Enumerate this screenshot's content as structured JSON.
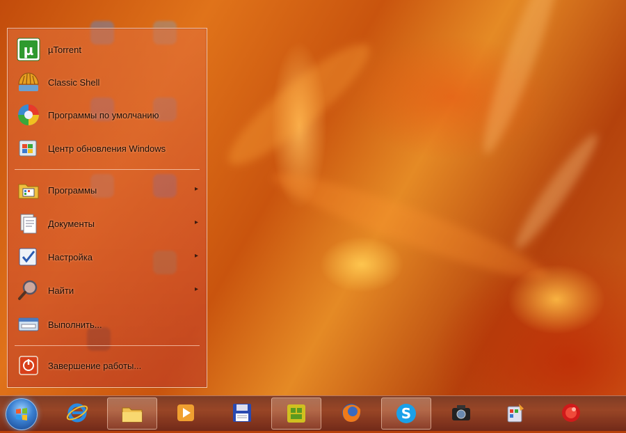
{
  "start_menu": {
    "pinned": [
      {
        "label": "µTorrent",
        "icon": "utorrent-icon"
      },
      {
        "label": "Classic Shell",
        "icon": "classic-shell-icon"
      },
      {
        "label": "Программы по умолчанию",
        "icon": "default-programs-icon"
      },
      {
        "label": "Центр обновления Windows",
        "icon": "windows-update-icon"
      }
    ],
    "main": [
      {
        "label": "Программы",
        "icon": "programs-folder-icon",
        "submenu": true
      },
      {
        "label": "Документы",
        "icon": "documents-icon",
        "submenu": true
      },
      {
        "label": "Настройка",
        "icon": "settings-icon",
        "submenu": true
      },
      {
        "label": "Найти",
        "icon": "search-magnifier-icon",
        "submenu": true
      },
      {
        "label": "Выполнить...",
        "icon": "run-icon",
        "submenu": false
      }
    ],
    "shutdown": {
      "label": "Завершение работы...",
      "icon": "power-icon"
    },
    "submenu_arrow": "▸"
  },
  "taskbar": {
    "start_button": "windows-orb-icon",
    "buttons": [
      {
        "name": "internet-explorer",
        "icon": "internet-explorer-icon"
      },
      {
        "name": "file-explorer",
        "icon": "folder-icon",
        "active": true
      },
      {
        "name": "media-player",
        "icon": "media-player-icon"
      },
      {
        "name": "save-app",
        "icon": "floppy-disk-icon"
      },
      {
        "name": "app-yellow",
        "icon": "yellow-app-icon",
        "active": true
      },
      {
        "name": "firefox",
        "icon": "firefox-icon"
      },
      {
        "name": "skype",
        "icon": "skype-icon",
        "active": true
      },
      {
        "name": "camera-app",
        "icon": "camera-icon"
      },
      {
        "name": "paint-app",
        "icon": "paint-icon"
      },
      {
        "name": "red-app",
        "icon": "red-app-icon"
      }
    ]
  },
  "colors": {
    "wallpaper_base": "#c24b0b",
    "menu_border": "#ffe6d2",
    "orb_blue": "#3a7fd0"
  }
}
